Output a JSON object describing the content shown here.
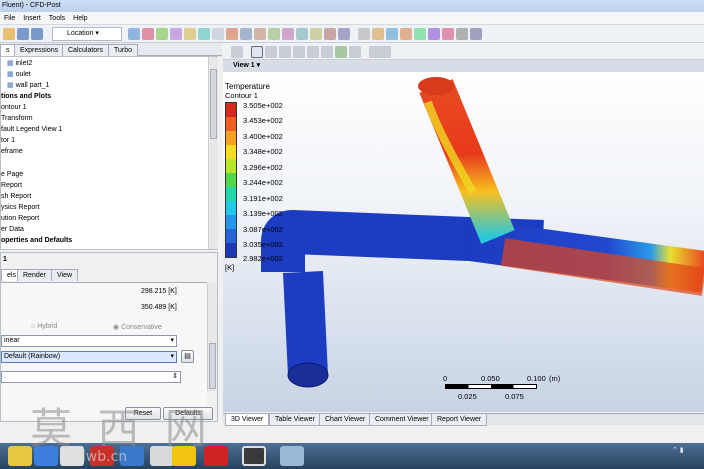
{
  "window_title": "Fluent) - CFD-Post",
  "menu": [
    "File",
    "Insert",
    "Tools",
    "Help"
  ],
  "toolbar": {
    "location_label": "Location"
  },
  "left_tabs": [
    "s",
    "Expressions",
    "Calculators",
    "Turbo"
  ],
  "tree_items": [
    "inlet2",
    "oulet",
    "wall part_1",
    "tions and Plots",
    "ontour 1",
    "Transform",
    "fault Legend View 1",
    "tor 1",
    "eframe",
    "",
    "e Page",
    "Report",
    "sh Report",
    "ysics Report",
    "ution Report",
    "er Data",
    "operties and Defaults"
  ],
  "detail": {
    "title": "1",
    "tabs": [
      "els",
      "Render",
      "View"
    ],
    "min_value": "298.215 [K]",
    "max_value": "350.489 [K]",
    "radio_hybrid": "Hybrid",
    "radio_conservative": "Conservative",
    "scale_value": "inear",
    "color_map_value": "Default (Rainbow)",
    "number_value": ".",
    "reset_label": "Reset",
    "defaults_label": "Defaults"
  },
  "view_title": "View 1",
  "legend": {
    "title": "Temperature",
    "subtitle": "Contour 1",
    "labels": [
      "3.505e+002",
      "3.453e+002",
      "3.400e+002",
      "3.348e+002",
      "3.296e+002",
      "3.244e+002",
      "3.191e+002",
      "3.139e+002",
      "3.087e+002",
      "3.035e+002",
      "2.982e+002"
    ],
    "unit": "[K]",
    "colors": [
      "#d62a1e",
      "#f06020",
      "#f7a020",
      "#f5dc20",
      "#b8e628",
      "#4fd84a",
      "#22d7a8",
      "#22c8e8",
      "#2496ee",
      "#2464d8",
      "#1c38b8"
    ]
  },
  "scale_bar": {
    "top_labels": [
      "0",
      "0.050",
      "0.100",
      "(m)"
    ],
    "bottom_labels": [
      "0.025",
      "0.075"
    ]
  },
  "bottom_tabs": [
    "3D Viewer",
    "Table Viewer",
    "Chart Viewer",
    "Comment Viewer",
    "Report Viewer"
  ],
  "watermark": {
    "chars": "莫 西 网",
    "url": "3dwb.cn"
  }
}
